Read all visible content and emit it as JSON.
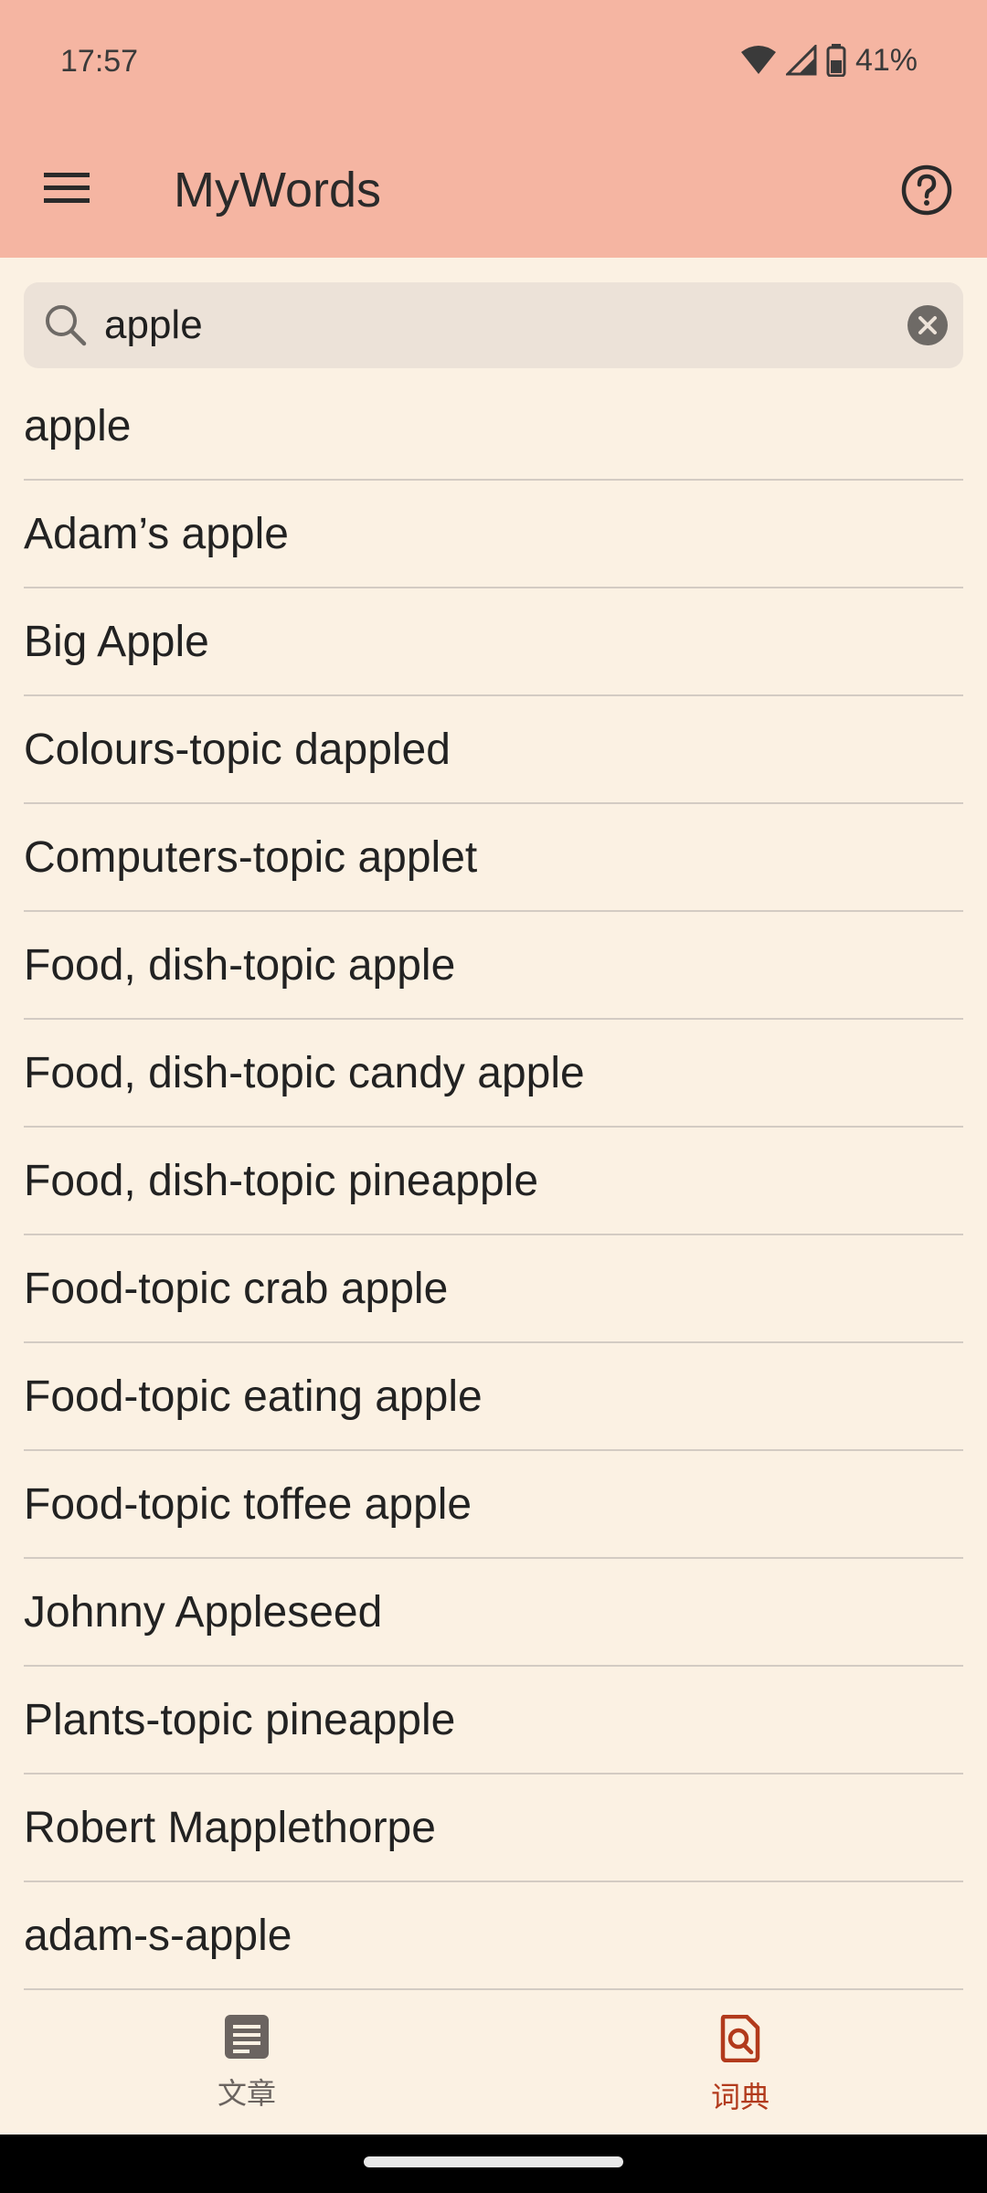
{
  "status_bar": {
    "time": "17:57",
    "battery": "41%",
    "icons": [
      "wifi-icon",
      "signal-icon",
      "battery-icon"
    ]
  },
  "app_bar": {
    "title": "MyWords",
    "menu_icon": "menu-icon",
    "help_icon": "help-icon"
  },
  "search": {
    "value": "apple",
    "placeholder": ""
  },
  "results": [
    "apple",
    "Adam’s apple",
    "Big Apple",
    "Colours-topic dappled",
    "Computers-topic applet",
    "Food, dish-topic apple",
    "Food, dish-topic candy apple",
    "Food, dish-topic pineapple",
    "Food-topic crab apple",
    "Food-topic eating apple",
    "Food-topic toffee apple",
    "Johnny Appleseed",
    "Plants-topic pineapple",
    "Robert Mapplethorpe",
    "adam-s-apple"
  ],
  "bottom_nav": {
    "items": [
      {
        "label": "文章",
        "icon": "article-icon",
        "active": false
      },
      {
        "label": "词典",
        "icon": "dictionary-search-icon",
        "active": true
      }
    ]
  },
  "colors": {
    "app_bar": "#F5B5A2",
    "background": "#FBF1E3",
    "search_box": "#ECE2D8",
    "accent": "#B23A1C"
  }
}
